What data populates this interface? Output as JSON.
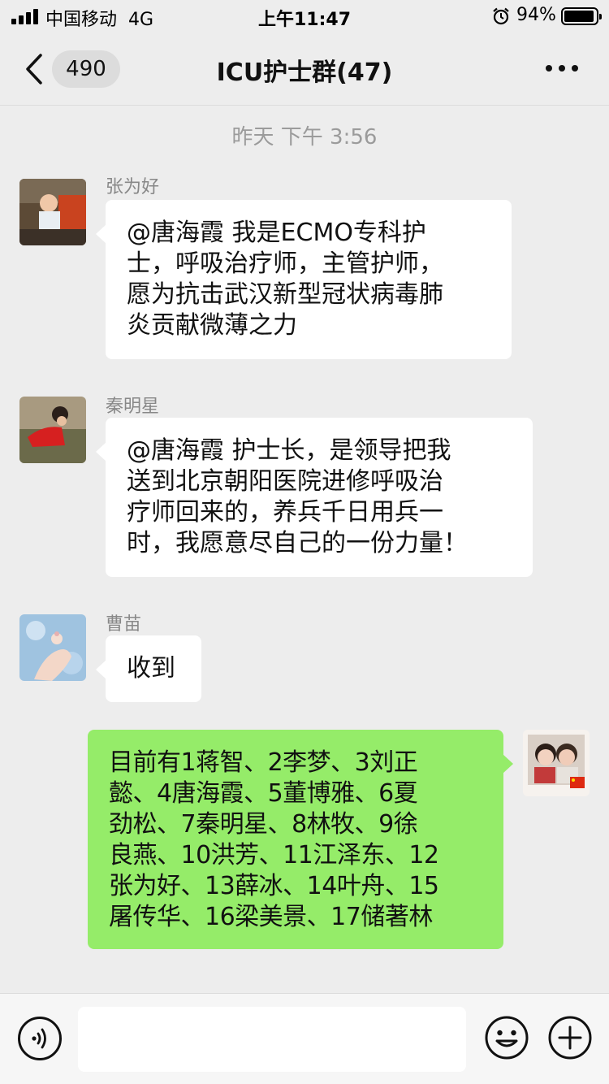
{
  "status_bar": {
    "carrier": "中国移动",
    "network": "4G",
    "time": "上午11:47",
    "battery": "94%",
    "battery_level": 0.94,
    "icons": [
      "signal-icon",
      "alarm-icon",
      "battery-icon"
    ]
  },
  "nav": {
    "back_count": "490",
    "title": "ICU护士群(47)",
    "icons": [
      "back-chevron-icon",
      "more-dots-icon"
    ]
  },
  "chat": {
    "timestamp": "昨天 下午 3:56",
    "messages": [
      {
        "sender": "张为好",
        "lines": [
          "@唐海霞 我是ECMO专科护",
          "士，呼吸治疗师，主管护师，",
          "愿为抗击武汉新型冠状病毒肺",
          "炎贡献微薄之力"
        ]
      },
      {
        "sender": "秦明星",
        "lines": [
          "@唐海霞 护士长，是领导把我",
          "送到北京朝阳医院进修呼吸治",
          "疗师回来的，养兵千日用兵一",
          "时，我愿意尽自己的一份力量！"
        ]
      },
      {
        "sender": "曹苗",
        "lines": [
          "收到"
        ]
      },
      {
        "sender": "",
        "mine": true,
        "lines": [
          "目前有1蒋智、2李梦、3刘正",
          "懿、4唐海霞、5董博雅、6夏",
          "劲松、7秦明星、8林牧、9徐",
          "良燕、10洪芳、11江泽东、12",
          "张为好、13薛冰、14叶舟、15",
          "屠传华、16梁美景、17储著林"
        ]
      }
    ]
  },
  "input_bar": {
    "icons": [
      "voice-icon",
      "emoji-icon",
      "plus-icon"
    ]
  },
  "colors": {
    "background": "#ededed",
    "bubble_incoming": "#ffffff",
    "bubble_outgoing": "#95ec69",
    "timestamp_text": "#9b9b9b",
    "sender_text": "#888888"
  }
}
